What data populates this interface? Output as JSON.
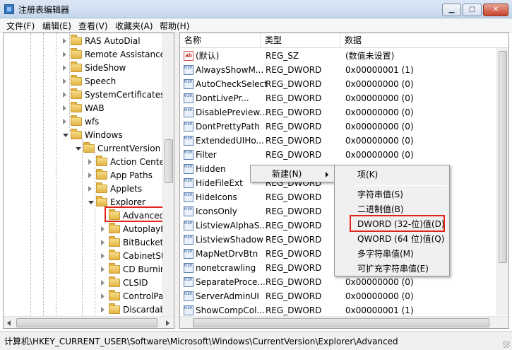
{
  "window": {
    "title": "注册表编辑器",
    "buttons": {
      "minimize": "▁",
      "maximize": "▢",
      "close": "✕"
    }
  },
  "menu": [
    "文件(F)",
    "编辑(E)",
    "查看(V)",
    "收藏夹(A)",
    "帮助(H)"
  ],
  "tree": {
    "items": [
      {
        "label": "RAS AutoDial",
        "state": "closed"
      },
      {
        "label": "Remote Assistance",
        "state": "closed"
      },
      {
        "label": "SideShow",
        "state": "closed"
      },
      {
        "label": "Speech",
        "state": "closed"
      },
      {
        "label": "SystemCertificates",
        "state": "closed"
      },
      {
        "label": "WAB",
        "state": "closed"
      },
      {
        "label": "wfs",
        "state": "closed"
      },
      {
        "label": "Windows",
        "state": "open"
      },
      {
        "label": "CurrentVersion",
        "state": "open"
      },
      {
        "label": "Action Center",
        "state": "closed"
      },
      {
        "label": "App Paths",
        "state": "closed"
      },
      {
        "label": "Applets",
        "state": "closed"
      },
      {
        "label": "Explorer",
        "state": "open"
      },
      {
        "label": "Advanced",
        "state": "selected"
      },
      {
        "label": "AutoplayH",
        "state": "closed"
      },
      {
        "label": "BitBucket",
        "state": "closed"
      },
      {
        "label": "CabinetSta",
        "state": "closed"
      },
      {
        "label": "CD Burning",
        "state": "closed"
      },
      {
        "label": "CLSID",
        "state": "closed"
      },
      {
        "label": "ControlPar",
        "state": "closed"
      },
      {
        "label": "Discardabl",
        "state": "closed"
      }
    ]
  },
  "list": {
    "headers": {
      "name": "名称",
      "type": "类型",
      "data": "数据"
    },
    "rows": [
      {
        "name": "(默认)",
        "type": "REG_SZ",
        "data": "(数值未设置)",
        "kind": "sz"
      },
      {
        "name": "AlwaysShowM...",
        "type": "REG_DWORD",
        "data": "0x00000001 (1)",
        "kind": "dword"
      },
      {
        "name": "AutoCheckSelect",
        "type": "REG_DWORD",
        "data": "0x00000000 (0)",
        "kind": "dword"
      },
      {
        "name": "DontLivePr...",
        "type": "REG_DWORD",
        "data": "0x00000000 (0)",
        "kind": "dword"
      },
      {
        "name": "DisablePreview...",
        "type": "REG_DWORD",
        "data": "0x00000000 (0)",
        "kind": "dword"
      },
      {
        "name": "DontPrettyPath",
        "type": "REG_DWORD",
        "data": "0x00000000 (0)",
        "kind": "dword"
      },
      {
        "name": "ExtendedUIHo...",
        "type": "REG_DWORD",
        "data": "0x00000000 (0)",
        "kind": "dword"
      },
      {
        "name": "Filter",
        "type": "REG_DWORD",
        "data": "0x00000000 (0)",
        "kind": "dword"
      },
      {
        "name": "Hidden",
        "type": "REG_DWORD",
        "data": "",
        "kind": "dword"
      },
      {
        "name": "HideFileExt",
        "type": "REG_DWORD",
        "data": "",
        "kind": "dword"
      },
      {
        "name": "HideIcons",
        "type": "REG_DWORD",
        "data": "",
        "kind": "dword"
      },
      {
        "name": "IconsOnly",
        "type": "REG_DWORD",
        "data": "",
        "kind": "dword"
      },
      {
        "name": "ListviewAlphaS...",
        "type": "REG_DWORD",
        "data": "",
        "kind": "dword"
      },
      {
        "name": "ListviewShadow",
        "type": "REG_DWORD",
        "data": "",
        "kind": "dword"
      },
      {
        "name": "MapNetDrvBtn",
        "type": "REG_DWORD",
        "data": "",
        "kind": "dword"
      },
      {
        "name": "nonetcrawling",
        "type": "REG_DWORD",
        "data": "",
        "kind": "dword"
      },
      {
        "name": "SeparateProce...",
        "type": "REG_DWORD",
        "data": "0x00000000 (0)",
        "kind": "dword"
      },
      {
        "name": "ServerAdminUI",
        "type": "REG_DWORD",
        "data": "0x00000000 (0)",
        "kind": "dword"
      },
      {
        "name": "ShowCompCol...",
        "type": "REG_DWORD",
        "data": "0x00000001 (1)",
        "kind": "dword"
      }
    ]
  },
  "context_menu": {
    "new_label": "新建(N)",
    "submenu": [
      "项(K)",
      "字符串值(S)",
      "二进制值(B)",
      "DWORD (32-位)值(D)",
      "QWORD (64 位)值(Q)",
      "多字符串值(M)",
      "可扩充字符串值(E)"
    ]
  },
  "status": {
    "path": "计算机\\HKEY_CURRENT_USER\\Software\\Microsoft\\Windows\\CurrentVersion\\Explorer\\Advanced"
  },
  "colors": {
    "highlight_box": "#e0231b"
  }
}
